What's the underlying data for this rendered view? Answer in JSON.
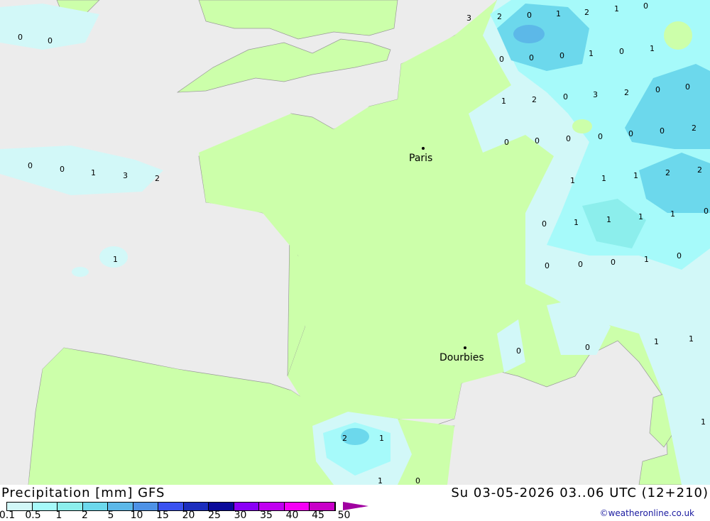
{
  "map": {
    "cities": [
      {
        "name": "Paris"
      },
      {
        "name": "Dourbies"
      }
    ],
    "grid_labels": [
      "0",
      "0",
      "3",
      "2",
      "0",
      "1",
      "2",
      "1",
      "0",
      "0",
      "0",
      "1",
      "3",
      "2",
      "1",
      "0",
      "0",
      "0",
      "1",
      "0",
      "1",
      "1",
      "2",
      "0",
      "3",
      "2",
      "0",
      "0",
      "0",
      "0",
      "0",
      "0",
      "0",
      "0",
      "2",
      "1",
      "1",
      "1",
      "2",
      "2",
      "0",
      "1",
      "1",
      "1",
      "1",
      "0",
      "0",
      "0",
      "0",
      "1",
      "0",
      "0",
      "0",
      "1",
      "1",
      "2",
      "1",
      "1",
      "0",
      "1"
    ],
    "colors": {
      "sea": "#ececec",
      "land": "#ccffaa"
    }
  },
  "legend": {
    "title": "Precipitation [mm] GFS",
    "valid": "Su 03-05-2026 03..06 UTC (12+210)",
    "credit": "©weatheronline.co.uk",
    "ticks": [
      "0.1",
      "0.5",
      "1",
      "2",
      "5",
      "10",
      "15",
      "20",
      "25",
      "30",
      "35",
      "40",
      "45",
      "50"
    ],
    "colors": [
      "#d2f8f8",
      "#a6fafa",
      "#8ceeec",
      "#6cd8ec",
      "#5cb8e8",
      "#4e92e6",
      "#3a52f0",
      "#1c2ebe",
      "#0a0a9a",
      "#8a00f6",
      "#c000f0",
      "#f400f4",
      "#c800c8"
    ]
  }
}
